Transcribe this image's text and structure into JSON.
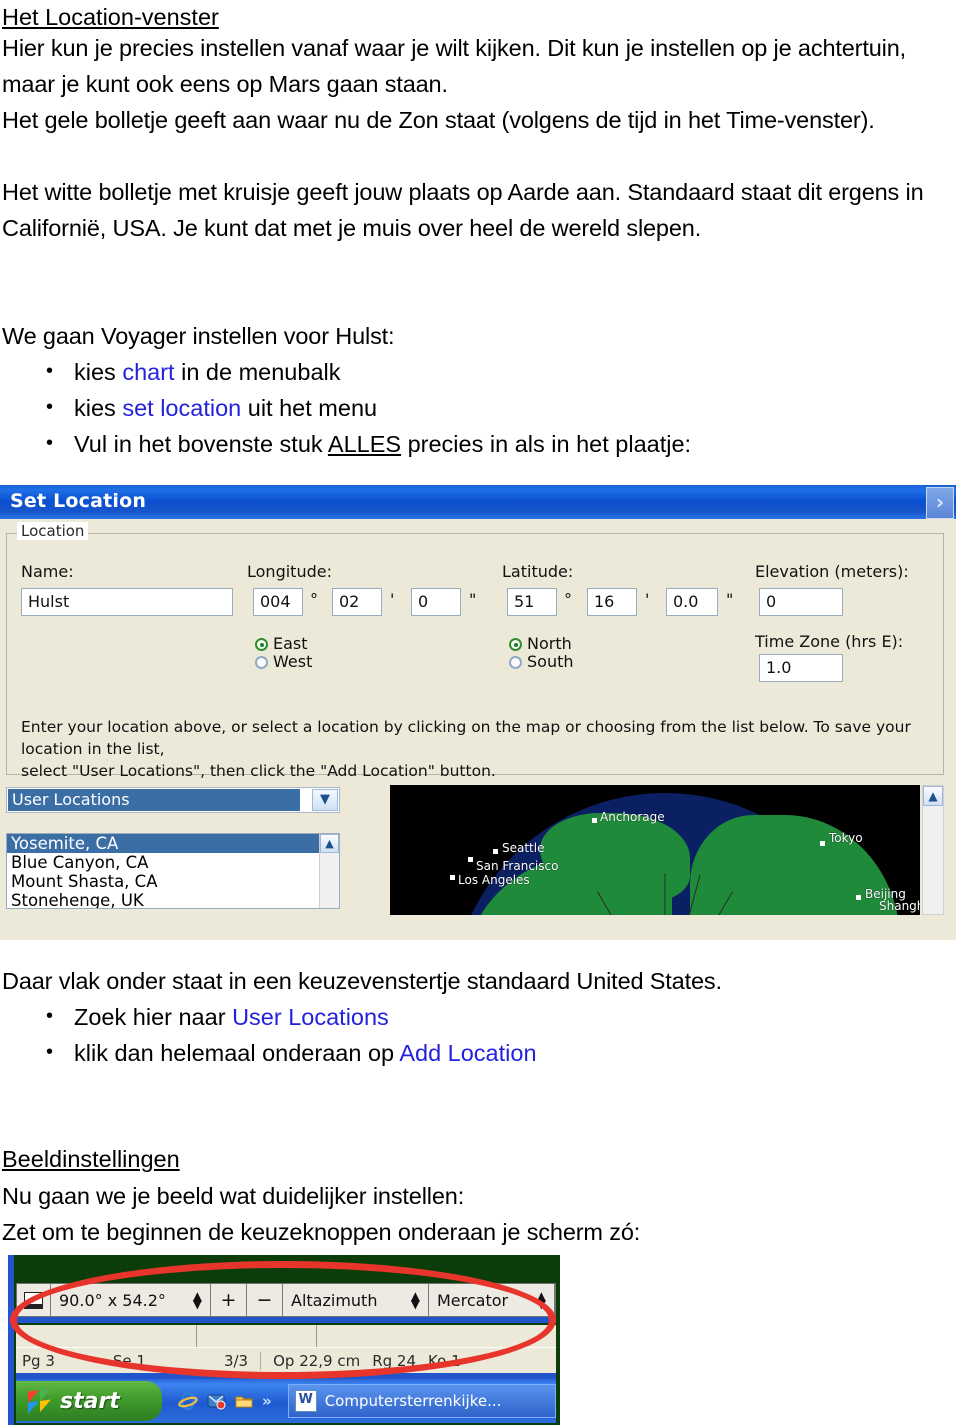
{
  "document": {
    "heading1": "Het Location-venster",
    "paragraph1": "Hier kun je precies instellen vanaf waar je wilt kijken. Dit kun je instellen op je achtertuin, maar je kunt ook eens op Mars gaan staan.",
    "paragraph2": "Het gele bolletje geeft aan waar nu de Zon staat (volgens de tijd in het Time-venster).",
    "paragraph3_a": "Het witte bolletje met kruisje geeft jouw plaats op Aarde aan.  Standaard staat dit ergens in Californië, USA. Je kunt dat met je muis over heel de wereld slepen.",
    "intro_hulst": "We gaan Voyager instellen voor Hulst:",
    "bullets1": [
      {
        "pre": "kies ",
        "link": "chart",
        "post": " in de menubalk"
      },
      {
        "pre": "kies ",
        "link": "set location",
        "post": " uit het menu"
      },
      {
        "pre": "Vul in het bovenste stuk ",
        "underline": "ALLES",
        "post": " precies in als in het plaatje:"
      }
    ],
    "paragraph4": "Daar vlak onder staat in een keuzevenstertje standaard United States.",
    "bullets2": [
      {
        "pre": "Zoek hier naar ",
        "link": "User Locations",
        "post": ""
      },
      {
        "pre": "klik dan helemaal onderaan op ",
        "link": "Add Location",
        "post": ""
      }
    ],
    "heading2": "Beeldinstellingen",
    "paragraph5": "Nu gaan we je beeld wat duidelijker instellen:",
    "paragraph6": "Zet om te beginnen de keuzeknoppen onderaan je scherm zó:"
  },
  "set_location_dialog": {
    "title": "Set Location",
    "title_button": "›",
    "group_legend": "Location",
    "labels": {
      "name": "Name:",
      "longitude": "Longitude:",
      "latitude": "Latitude:",
      "elevation": "Elevation (meters):",
      "timezone": "Time Zone (hrs E):"
    },
    "values": {
      "name": "Hulst",
      "lon_deg": "004",
      "lon_min": "02",
      "lon_sec": "0",
      "lat_deg": "51",
      "lat_min": "16",
      "lat_sec": "0.0",
      "elevation": "0",
      "timezone": "1.0"
    },
    "units": {
      "deg": "°",
      "min": "'",
      "sec": "\""
    },
    "radios": {
      "east": "East",
      "west": "West",
      "north": "North",
      "south": "South",
      "lon_selected": "East",
      "lat_selected": "North"
    },
    "help_line1": "Enter your location above, or select a location by clicking on the map or choosing from the list below.  To save your location in the list,",
    "help_line2": "select \"User Locations\", then click the \"Add Location\" button.",
    "combo_value": "User Locations",
    "list_items": [
      "Yosemite, CA",
      "Blue Canyon, CA",
      "Mount Shasta, CA",
      "Stonehenge, UK"
    ],
    "list_selected": "Yosemite, CA",
    "map_cities": [
      "Anchorage",
      "Seattle",
      "San Francisco",
      "Los Angeles",
      "Tokyo",
      "Beijing",
      "Shanghai"
    ],
    "colors": {
      "titlebar": "#0a4fd0",
      "selection": "#3a6ea5",
      "land": "#1f8a3a",
      "ocean": "#0b1f63",
      "space": "#000000",
      "icecap": "#e8e8e8"
    }
  },
  "voyager_toolbar": {
    "field_of_view": "90.0° x 54.2°",
    "zoom_in": "+",
    "zoom_out": "−",
    "coordinate_mode": "Altazimuth",
    "projection": "Mercator",
    "spinner_up": "▲",
    "spinner_down": "▼"
  },
  "word_status_bar": {
    "segments": [
      "Pg 3",
      "Se 1",
      "3/3"
    ],
    "segments2": [
      "Op 22,9 cm",
      "Rg 24",
      "Ko 1"
    ]
  },
  "taskbar": {
    "start_label": "start",
    "quicklaunch": [
      "internet-explorer-icon",
      "outlook-express-icon",
      "show-desktop-folder-icon"
    ],
    "overflow": "»",
    "task_label": "Computersterrenkijke...",
    "task_icon_letter": "W"
  }
}
